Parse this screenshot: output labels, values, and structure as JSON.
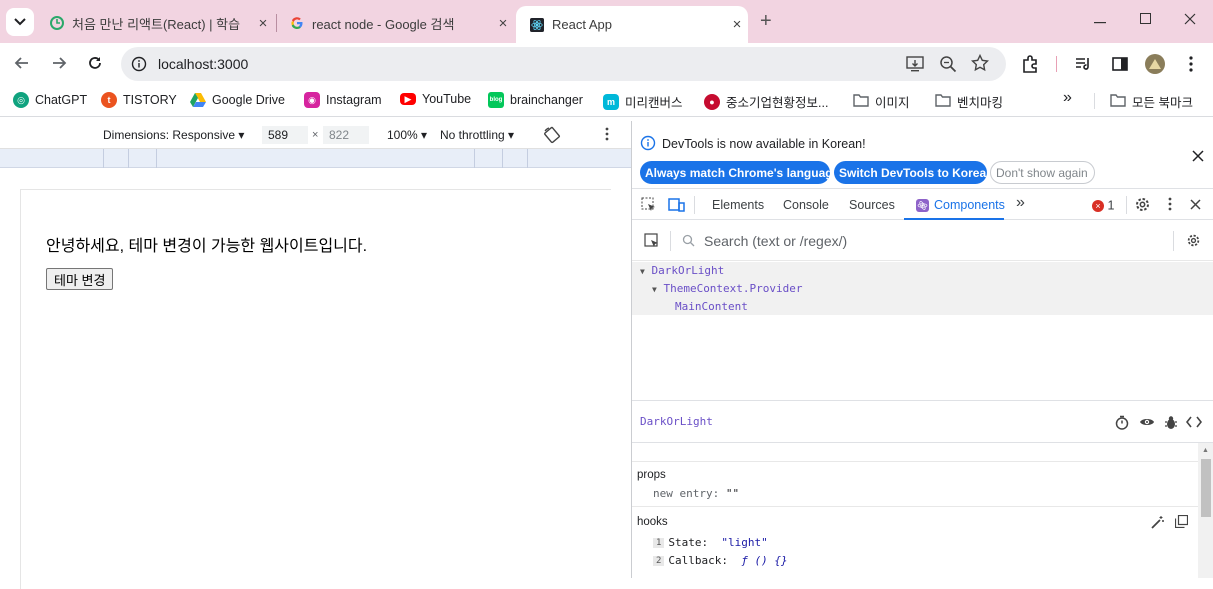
{
  "tabs": [
    {
      "title": "처음 만난 리액트(React) | 학습",
      "close": "×",
      "icon": "green-refresh-icon"
    },
    {
      "title": "react node - Google 검색",
      "close": "×",
      "icon": "google-g-icon"
    },
    {
      "title": "React App",
      "close": "×",
      "icon": "react-icon",
      "active": true
    }
  ],
  "new_tab": "+",
  "address": {
    "url": "localhost:3000"
  },
  "bookmarks": [
    {
      "label": "ChatGPT",
      "icon": "chatgpt-icon",
      "color": "#10a37f"
    },
    {
      "label": "TISTORY",
      "icon": "tistory-icon",
      "color": "#eb531f"
    },
    {
      "label": "Google Drive",
      "icon": "drive-icon",
      "color": "#1fa463"
    },
    {
      "label": "Instagram",
      "icon": "instagram-icon",
      "color": "#d6249f"
    },
    {
      "label": "YouTube",
      "icon": "youtube-icon",
      "color": "#ff0000"
    },
    {
      "label": "brainchanger",
      "icon": "blog-icon",
      "color": "#03c75a"
    },
    {
      "label": "미리캔버스",
      "icon": "miricanvas-icon",
      "color": "#00b8d9"
    },
    {
      "label": "중소기업현황정보...",
      "icon": "korea-flag-icon",
      "color": "#c60c30"
    },
    {
      "label": "이미지",
      "icon": "folder-icon",
      "color": "#5f6368"
    },
    {
      "label": "벤치마킹",
      "icon": "folder-icon",
      "color": "#5f6368"
    },
    {
      "label": "»",
      "icon": "more-icon",
      "color": "#202124"
    },
    {
      "label": "모든 북마크",
      "icon": "folder-icon",
      "color": "#5f6368"
    }
  ],
  "device_toolbar": {
    "dimensions": "Dimensions: Responsive",
    "width": "589",
    "height": "822",
    "times": "×",
    "zoom": "100%",
    "throttle": "No throttling"
  },
  "page": {
    "greeting": "안녕하세요, 테마 변경이 가능한 웹사이트입니다.",
    "button": "테마 변경"
  },
  "devtools": {
    "notice": "DevTools is now available in Korean!",
    "btn_match": "Always match Chrome's language",
    "btn_switch": "Switch DevTools to Korean",
    "btn_dont": "Don't show again",
    "tabs": [
      "Elements",
      "Console",
      "Sources",
      "Components"
    ],
    "active_tab": "Components",
    "error_count": "1",
    "search_placeholder": "Search (text or /regex/)",
    "tree": [
      "DarkOrLight",
      "ThemeContext.Provider",
      "MainContent"
    ],
    "selected_component": "DarkOrLight",
    "props_title": "props",
    "props_key": "new entry",
    "props_val": "\"\"",
    "hooks_title": "hooks",
    "hooks": [
      {
        "idx": "1",
        "name": "State",
        "value": "\"light\""
      },
      {
        "idx": "2",
        "name": "Callback",
        "value": "ƒ () {}"
      }
    ]
  },
  "colors": {
    "titlebar": "#f2d4e1",
    "accent": "#1a73e8",
    "components_tab": "#1a73e8"
  }
}
